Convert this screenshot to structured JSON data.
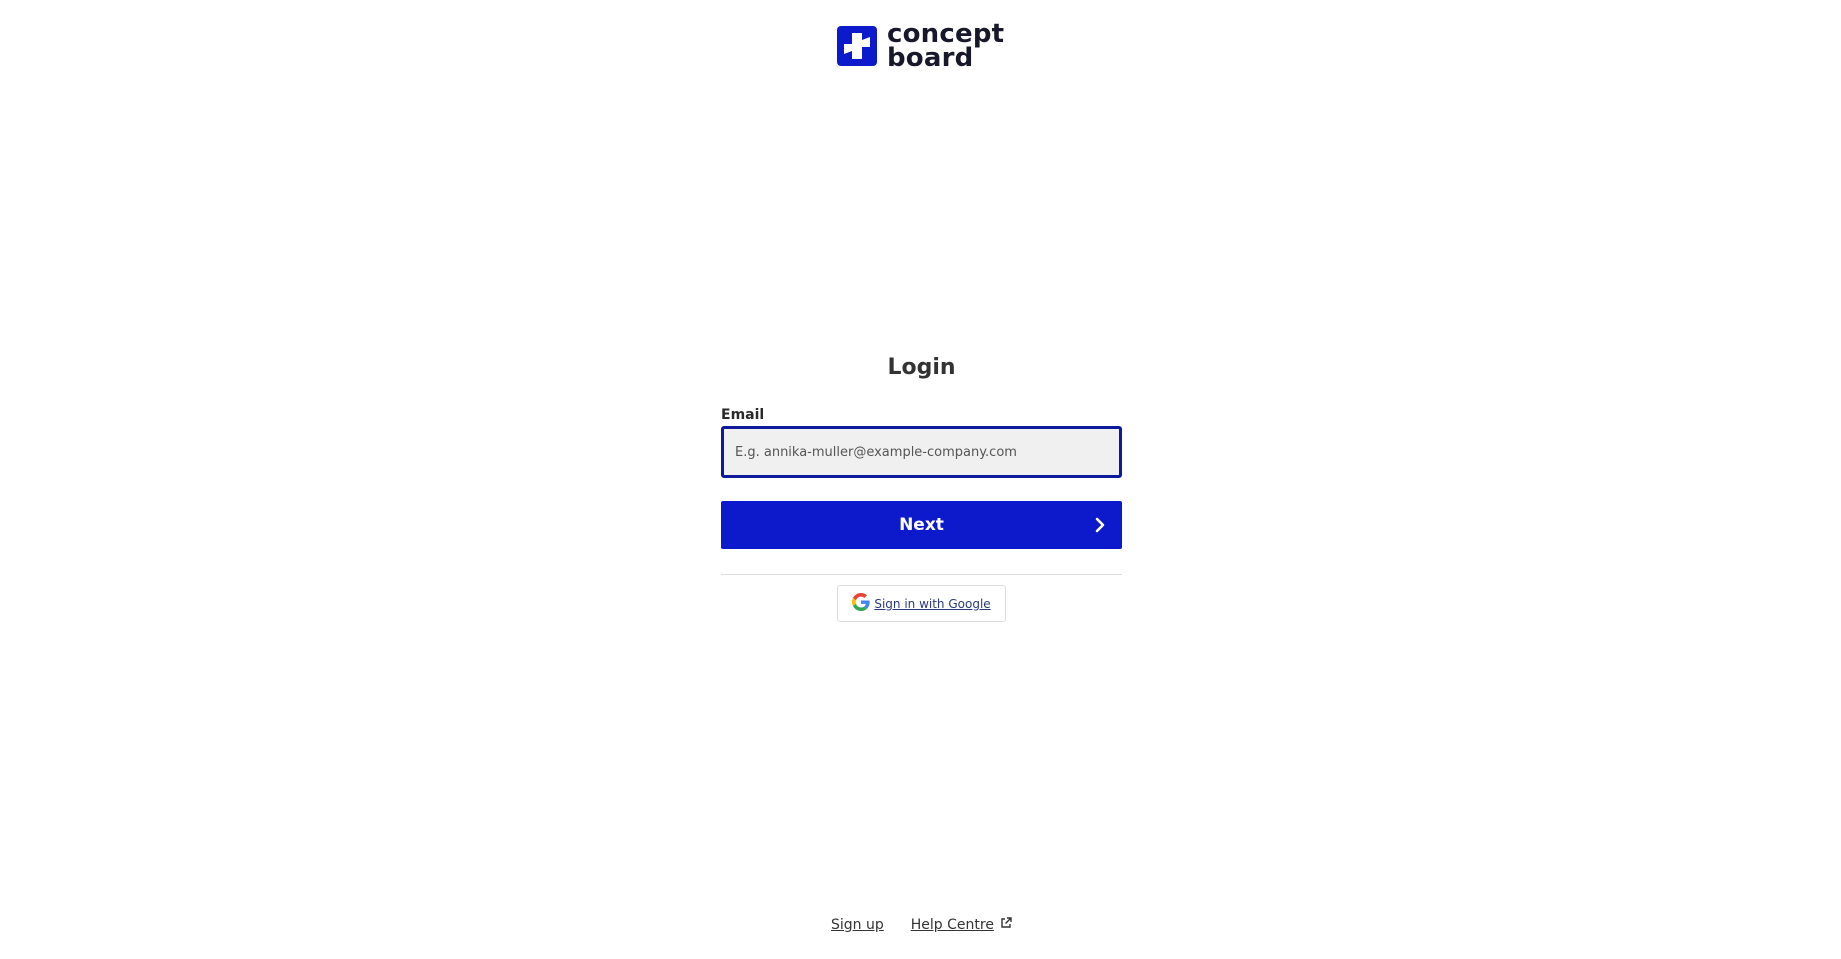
{
  "brand": {
    "name_line1": "concept",
    "name_line2": "board",
    "color": "#0c1acb",
    "icon": "plus-cross-logo-icon"
  },
  "login": {
    "title": "Login",
    "email_label": "Email",
    "email_placeholder": "E.g. annika-muller@example-company.com",
    "email_value": "",
    "next_label": "Next",
    "next_icon": "chevron-right-icon",
    "google_label": "Sign in with Google",
    "google_icon": "google-g-icon"
  },
  "footer": {
    "signup_label": "Sign up",
    "help_label": "Help Centre",
    "help_icon": "external-link-icon"
  }
}
